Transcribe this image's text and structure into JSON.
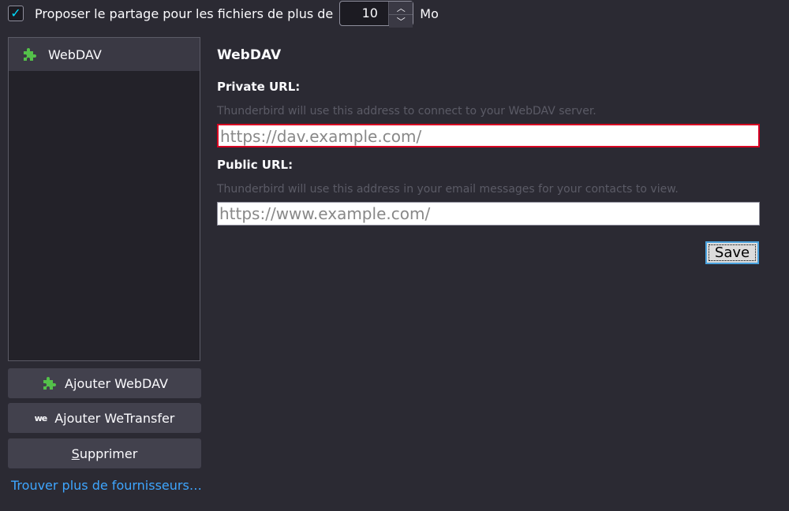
{
  "top_option": {
    "checked": true,
    "label": "Proposer le partage pour les fichiers de plus de",
    "size_value": "10",
    "unit": "Mo"
  },
  "providers": {
    "items": [
      {
        "label": "WebDAV",
        "icon": "puzzle-icon"
      }
    ]
  },
  "buttons": {
    "add_webdav": "Ajouter WebDAV",
    "add_wetransfer": "Ajouter WeTransfer",
    "delete_prefix": "S",
    "delete_rest": "upprimer",
    "find_more": "Trouver plus de fournisseurs…"
  },
  "settings": {
    "title": "WebDAV",
    "private_label": "Private URL:",
    "private_hint": "Thunderbird will use this address to connect to your WebDAV server.",
    "private_placeholder": "https://dav.example.com/",
    "public_label": "Public URL:",
    "public_hint": "Thunderbird will use this address in your email messages for your contacts to view.",
    "public_placeholder": "https://www.example.com/",
    "save_label": "Save"
  },
  "colors": {
    "background": "#2b2a33",
    "accent": "#00ddff",
    "link": "#3ea6ff",
    "invalid_border": "#d70022",
    "puzzle_green": "#45a1ff"
  }
}
